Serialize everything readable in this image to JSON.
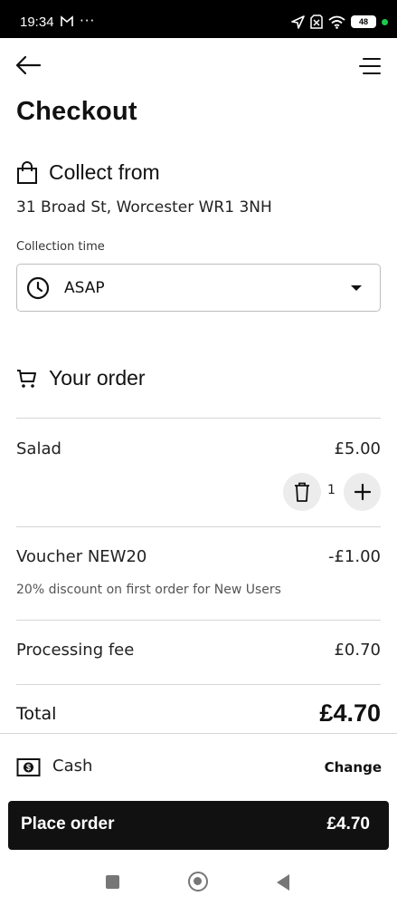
{
  "status_bar": {
    "time": "19:34",
    "overflow": "···",
    "battery": "48",
    "icons": [
      "gmail-icon",
      "location-arrow-icon",
      "no-sim-icon",
      "wifi-icon",
      "battery-icon",
      "active-dot"
    ]
  },
  "header": {
    "back_icon": "arrow-left-icon",
    "menu_icon": "hamburger-menu-icon",
    "title": "Checkout"
  },
  "collect": {
    "heading": "Collect from",
    "address": "31 Broad St, Worcester WR1 3NH",
    "time_label": "Collection time",
    "time_value": "ASAP"
  },
  "order": {
    "heading": "Your order",
    "items": [
      {
        "name": "Salad",
        "price": "£5.00",
        "quantity": "1"
      }
    ],
    "voucher": {
      "label": "Voucher NEW20",
      "amount": "-£1.00",
      "description": "20% discount on first order for New Users"
    },
    "fee": {
      "label": "Processing fee",
      "amount": "£0.70"
    },
    "total": {
      "label": "Total",
      "amount": "£4.70"
    }
  },
  "payment": {
    "method": "Cash",
    "change_label": "Change"
  },
  "cta": {
    "label": "Place order",
    "amount": "£4.70"
  },
  "colors": {
    "primary": "#111111",
    "button_bg": "#111111",
    "button_text": "#ffffff",
    "chip_bg": "#ececec",
    "divider": "#d6d6d6",
    "status_dot": "#1ec94a"
  }
}
